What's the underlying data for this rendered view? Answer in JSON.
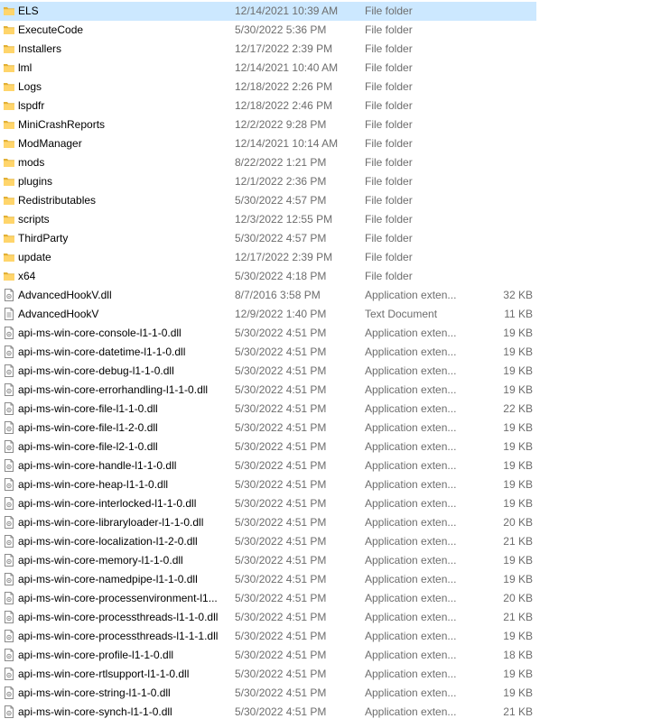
{
  "colors": {
    "folder": "#ffd56b",
    "folder_dark": "#e2b035",
    "selection": "#cce8ff",
    "secondary_text": "#6d6d6d"
  },
  "files": [
    {
      "name": "ELS",
      "date": "12/14/2021 10:39 AM",
      "type": "File folder",
      "size": "",
      "icon": "folder-icon",
      "selected": true
    },
    {
      "name": "ExecuteCode",
      "date": "5/30/2022 5:36 PM",
      "type": "File folder",
      "size": "",
      "icon": "folder-icon"
    },
    {
      "name": "Installers",
      "date": "12/17/2022 2:39 PM",
      "type": "File folder",
      "size": "",
      "icon": "folder-icon"
    },
    {
      "name": "lml",
      "date": "12/14/2021 10:40 AM",
      "type": "File folder",
      "size": "",
      "icon": "folder-icon"
    },
    {
      "name": "Logs",
      "date": "12/18/2022 2:26 PM",
      "type": "File folder",
      "size": "",
      "icon": "folder-icon"
    },
    {
      "name": "lspdfr",
      "date": "12/18/2022 2:46 PM",
      "type": "File folder",
      "size": "",
      "icon": "folder-icon"
    },
    {
      "name": "MiniCrashReports",
      "date": "12/2/2022 9:28 PM",
      "type": "File folder",
      "size": "",
      "icon": "folder-icon"
    },
    {
      "name": "ModManager",
      "date": "12/14/2021 10:14 AM",
      "type": "File folder",
      "size": "",
      "icon": "folder-icon"
    },
    {
      "name": "mods",
      "date": "8/22/2022 1:21 PM",
      "type": "File folder",
      "size": "",
      "icon": "folder-icon"
    },
    {
      "name": "plugins",
      "date": "12/1/2022 2:36 PM",
      "type": "File folder",
      "size": "",
      "icon": "folder-icon"
    },
    {
      "name": "Redistributables",
      "date": "5/30/2022 4:57 PM",
      "type": "File folder",
      "size": "",
      "icon": "folder-icon"
    },
    {
      "name": "scripts",
      "date": "12/3/2022 12:55 PM",
      "type": "File folder",
      "size": "",
      "icon": "folder-icon"
    },
    {
      "name": "ThirdParty",
      "date": "5/30/2022 4:57 PM",
      "type": "File folder",
      "size": "",
      "icon": "folder-icon"
    },
    {
      "name": "update",
      "date": "12/17/2022 2:39 PM",
      "type": "File folder",
      "size": "",
      "icon": "folder-icon"
    },
    {
      "name": "x64",
      "date": "5/30/2022 4:18 PM",
      "type": "File folder",
      "size": "",
      "icon": "folder-icon"
    },
    {
      "name": "AdvancedHookV.dll",
      "date": "8/7/2016 3:58 PM",
      "type": "Application exten...",
      "size": "32 KB",
      "icon": "dll-file-icon"
    },
    {
      "name": "AdvancedHookV",
      "date": "12/9/2022 1:40 PM",
      "type": "Text Document",
      "size": "11 KB",
      "icon": "text-file-icon"
    },
    {
      "name": "api-ms-win-core-console-l1-1-0.dll",
      "date": "5/30/2022 4:51 PM",
      "type": "Application exten...",
      "size": "19 KB",
      "icon": "dll-file-icon"
    },
    {
      "name": "api-ms-win-core-datetime-l1-1-0.dll",
      "date": "5/30/2022 4:51 PM",
      "type": "Application exten...",
      "size": "19 KB",
      "icon": "dll-file-icon"
    },
    {
      "name": "api-ms-win-core-debug-l1-1-0.dll",
      "date": "5/30/2022 4:51 PM",
      "type": "Application exten...",
      "size": "19 KB",
      "icon": "dll-file-icon"
    },
    {
      "name": "api-ms-win-core-errorhandling-l1-1-0.dll",
      "date": "5/30/2022 4:51 PM",
      "type": "Application exten...",
      "size": "19 KB",
      "icon": "dll-file-icon"
    },
    {
      "name": "api-ms-win-core-file-l1-1-0.dll",
      "date": "5/30/2022 4:51 PM",
      "type": "Application exten...",
      "size": "22 KB",
      "icon": "dll-file-icon"
    },
    {
      "name": "api-ms-win-core-file-l1-2-0.dll",
      "date": "5/30/2022 4:51 PM",
      "type": "Application exten...",
      "size": "19 KB",
      "icon": "dll-file-icon"
    },
    {
      "name": "api-ms-win-core-file-l2-1-0.dll",
      "date": "5/30/2022 4:51 PM",
      "type": "Application exten...",
      "size": "19 KB",
      "icon": "dll-file-icon"
    },
    {
      "name": "api-ms-win-core-handle-l1-1-0.dll",
      "date": "5/30/2022 4:51 PM",
      "type": "Application exten...",
      "size": "19 KB",
      "icon": "dll-file-icon"
    },
    {
      "name": "api-ms-win-core-heap-l1-1-0.dll",
      "date": "5/30/2022 4:51 PM",
      "type": "Application exten...",
      "size": "19 KB",
      "icon": "dll-file-icon"
    },
    {
      "name": "api-ms-win-core-interlocked-l1-1-0.dll",
      "date": "5/30/2022 4:51 PM",
      "type": "Application exten...",
      "size": "19 KB",
      "icon": "dll-file-icon"
    },
    {
      "name": "api-ms-win-core-libraryloader-l1-1-0.dll",
      "date": "5/30/2022 4:51 PM",
      "type": "Application exten...",
      "size": "20 KB",
      "icon": "dll-file-icon"
    },
    {
      "name": "api-ms-win-core-localization-l1-2-0.dll",
      "date": "5/30/2022 4:51 PM",
      "type": "Application exten...",
      "size": "21 KB",
      "icon": "dll-file-icon"
    },
    {
      "name": "api-ms-win-core-memory-l1-1-0.dll",
      "date": "5/30/2022 4:51 PM",
      "type": "Application exten...",
      "size": "19 KB",
      "icon": "dll-file-icon"
    },
    {
      "name": "api-ms-win-core-namedpipe-l1-1-0.dll",
      "date": "5/30/2022 4:51 PM",
      "type": "Application exten...",
      "size": "19 KB",
      "icon": "dll-file-icon"
    },
    {
      "name": "api-ms-win-core-processenvironment-l1...",
      "date": "5/30/2022 4:51 PM",
      "type": "Application exten...",
      "size": "20 KB",
      "icon": "dll-file-icon"
    },
    {
      "name": "api-ms-win-core-processthreads-l1-1-0.dll",
      "date": "5/30/2022 4:51 PM",
      "type": "Application exten...",
      "size": "21 KB",
      "icon": "dll-file-icon"
    },
    {
      "name": "api-ms-win-core-processthreads-l1-1-1.dll",
      "date": "5/30/2022 4:51 PM",
      "type": "Application exten...",
      "size": "19 KB",
      "icon": "dll-file-icon"
    },
    {
      "name": "api-ms-win-core-profile-l1-1-0.dll",
      "date": "5/30/2022 4:51 PM",
      "type": "Application exten...",
      "size": "18 KB",
      "icon": "dll-file-icon"
    },
    {
      "name": "api-ms-win-core-rtlsupport-l1-1-0.dll",
      "date": "5/30/2022 4:51 PM",
      "type": "Application exten...",
      "size": "19 KB",
      "icon": "dll-file-icon"
    },
    {
      "name": "api-ms-win-core-string-l1-1-0.dll",
      "date": "5/30/2022 4:51 PM",
      "type": "Application exten...",
      "size": "19 KB",
      "icon": "dll-file-icon"
    },
    {
      "name": "api-ms-win-core-synch-l1-1-0.dll",
      "date": "5/30/2022 4:51 PM",
      "type": "Application exten...",
      "size": "21 KB",
      "icon": "dll-file-icon"
    }
  ]
}
